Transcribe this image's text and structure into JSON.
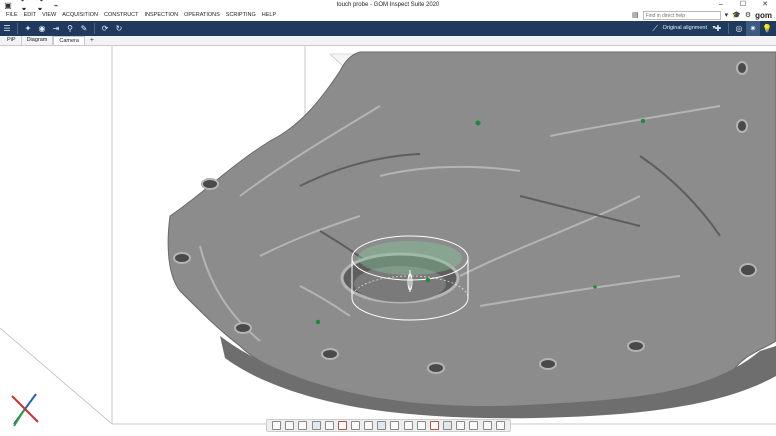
{
  "window": {
    "title": "touch probe - GOM Inspect Suite 2020",
    "controls": [
      "–",
      "☐",
      "✕"
    ],
    "quick_icons": [
      "▣",
      "↶ ▾",
      "↷ ▾",
      "⌁"
    ]
  },
  "menubar": {
    "items": [
      "FILE",
      "EDIT",
      "VIEW",
      "ACQUISITION",
      "CONSTRUCT",
      "INSPECTION",
      "OPERATIONS",
      "SCRIPTING",
      "HELP"
    ],
    "search_placeholder": "Find in direct help",
    "brand": "gom"
  },
  "toolbar": {
    "left_icons": [
      "☰",
      "✦",
      "◉",
      "⇥",
      "⚲",
      "✎",
      "⟳",
      "↻"
    ],
    "alignment_label": "Original alignment",
    "right_icons": [
      "✚",
      "◎",
      "✷",
      "💡"
    ]
  },
  "tabs": {
    "items": [
      "PiP",
      "Diagram",
      "Camera"
    ],
    "active_index": 2,
    "add_label": "+"
  },
  "viewport": {
    "scene": "3d-mesh-housing-with-touch-probe-cylinder",
    "colors": {
      "mesh": "#8c8c8c",
      "mesh_dark": "#5e5e5e",
      "mesh_light": "#b4b4b4",
      "probe_points": "#1e8a3c",
      "grid_lines": "#c8c8c8",
      "cylinder": "#ffffff"
    }
  },
  "triad": {
    "axis_colors": {
      "x": "#c83232",
      "y": "#2e9e3e",
      "z": "#2c5fb5"
    }
  },
  "view_toolbar": {
    "icon_count": 18
  }
}
